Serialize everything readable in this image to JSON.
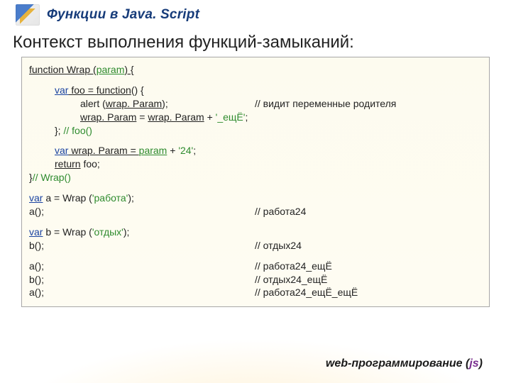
{
  "header": {
    "title": "Функции в Java. Script"
  },
  "heading": "Контекст выполнения функций-замыканий:",
  "code": {
    "l1a": "function",
    "l1b": " Wrap (",
    "l1c": "param",
    "l1d": ") {",
    "l2a": "var",
    "l2b": " foo = ",
    "l2c": "function",
    "l2d": "() {",
    "l3a": "alert (",
    "l3b": "wrap. Param",
    "l3c": ");",
    "l3cmt": "// видит переменные родителя",
    "l4a": "wrap. Param",
    "l4b": " = ",
    "l4c": "wrap. Param",
    "l4d": " + ",
    "l4e": "'_ещЁ'",
    "l4f": ";",
    "l5a": "}; ",
    "l5cmt": "// foo()",
    "l6a": "var",
    "l6b": " wrap. Param = ",
    "l6c": "param",
    "l6d": " + ",
    "l6e": "'24'",
    "l6f": ";",
    "l7a": "return",
    "l7b": " foo;",
    "l8a": "}",
    "l8cmt": "// Wrap()",
    "l9a": "var",
    "l9b": " a = Wrap (",
    "l9c": "'работа'",
    "l9d": ");",
    "l10a": "a();",
    "l10cmt": "// работа24",
    "l11a": "var",
    "l11b": " b = Wrap (",
    "l11c": "'отдых'",
    "l11d": ");",
    "l12a": "b();",
    "l12cmt": "// отдых24",
    "l13a": "a();",
    "l13cmt": "// работа24_ещЁ",
    "l14a": "b();",
    "l14cmt": "// отдых24_ещЁ",
    "l15a": "a();",
    "l15cmt": "// работа24_ещЁ_ещЁ"
  },
  "footer": {
    "text": "web-программирование (",
    "lang": "js",
    "close": ")"
  }
}
